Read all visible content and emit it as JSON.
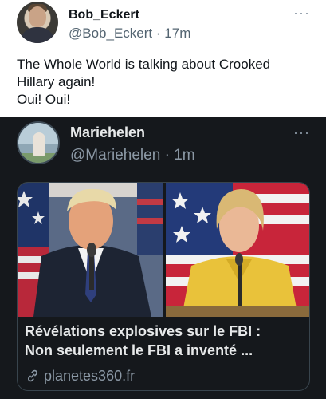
{
  "outer_tweet": {
    "display_name": "Bob_Eckert",
    "handle": "@Bob_Eckert",
    "separator": "·",
    "time": "17m",
    "more_icon": "more-horizontal-icon",
    "text_lines": [
      "The Whole World is talking about Crooked",
      "Hillary again!",
      "Oui! Oui!"
    ]
  },
  "quoted_tweet": {
    "display_name": "Mariehelen",
    "handle": "@Mariehelen",
    "separator": "·",
    "time": "1m",
    "more_icon": "more-horizontal-icon",
    "card": {
      "title_lines": [
        "Révélations explosives sur le FBI :",
        "Non seulement le FBI a inventé ..."
      ],
      "link_icon": "link-icon",
      "domain": "planetes360.fr"
    }
  },
  "colors": {
    "outer_bg": "#ffffff",
    "quoted_bg": "#15181c",
    "primary_text_dark": "#0f1419",
    "primary_text_light": "#e7e9ea",
    "secondary_text": "#8b98a5",
    "hillary_jacket": "#e9c23a",
    "flag_red": "#b8283a",
    "flag_blue": "#1f3467"
  }
}
